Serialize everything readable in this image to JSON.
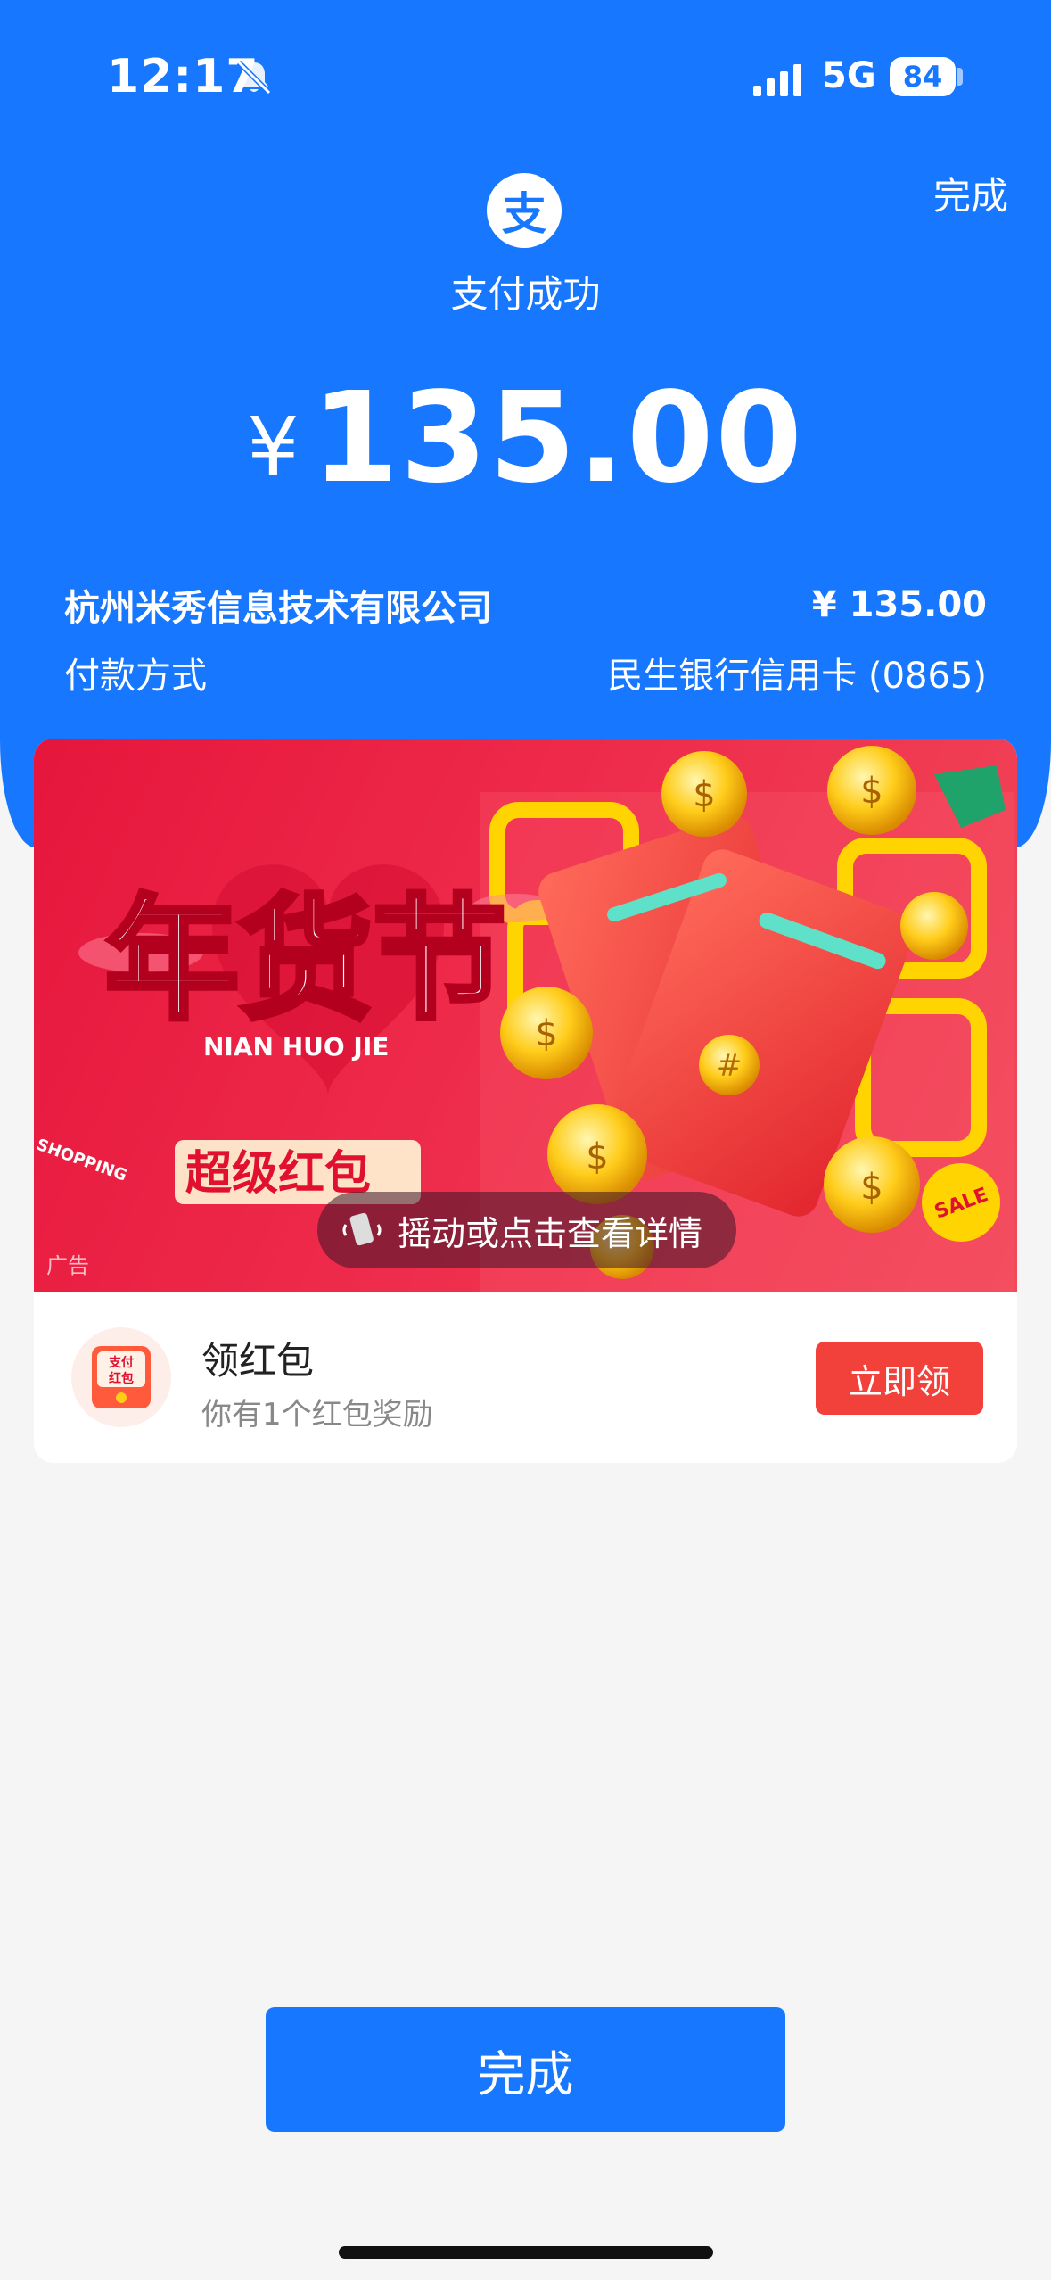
{
  "status_bar": {
    "time": "12:17",
    "network": "5G",
    "battery": "84"
  },
  "header": {
    "done_label": "完成",
    "logo_glyph": "支",
    "status_text": "支付成功"
  },
  "payment": {
    "currency_symbol": "¥",
    "amount": "135.00",
    "merchant_name": "杭州米秀信息技术有限公司",
    "merchant_amount": "¥ 135.00",
    "method_label": "付款方式",
    "method_value": "民生银行信用卡 (0865)"
  },
  "ad": {
    "ad_tag": "广告",
    "banner_title": "年货节",
    "banner_subtitle": "NIAN HUO JIE",
    "banner_tagline": "超级红包",
    "banner_shopping": "SHOPPING",
    "banner_sale": "SALE",
    "shake_text": "摇动或点击查看详情"
  },
  "reward": {
    "icon_text_line1": "支付",
    "icon_text_line2": "红包",
    "title": "领红包",
    "subtitle": "你有1个红包奖励",
    "claim_label": "立即领"
  },
  "footer": {
    "done_label": "完成"
  },
  "colors": {
    "brand_blue": "#1777ff",
    "claim_red": "#f2403a",
    "banner_red": "#e6163c"
  }
}
